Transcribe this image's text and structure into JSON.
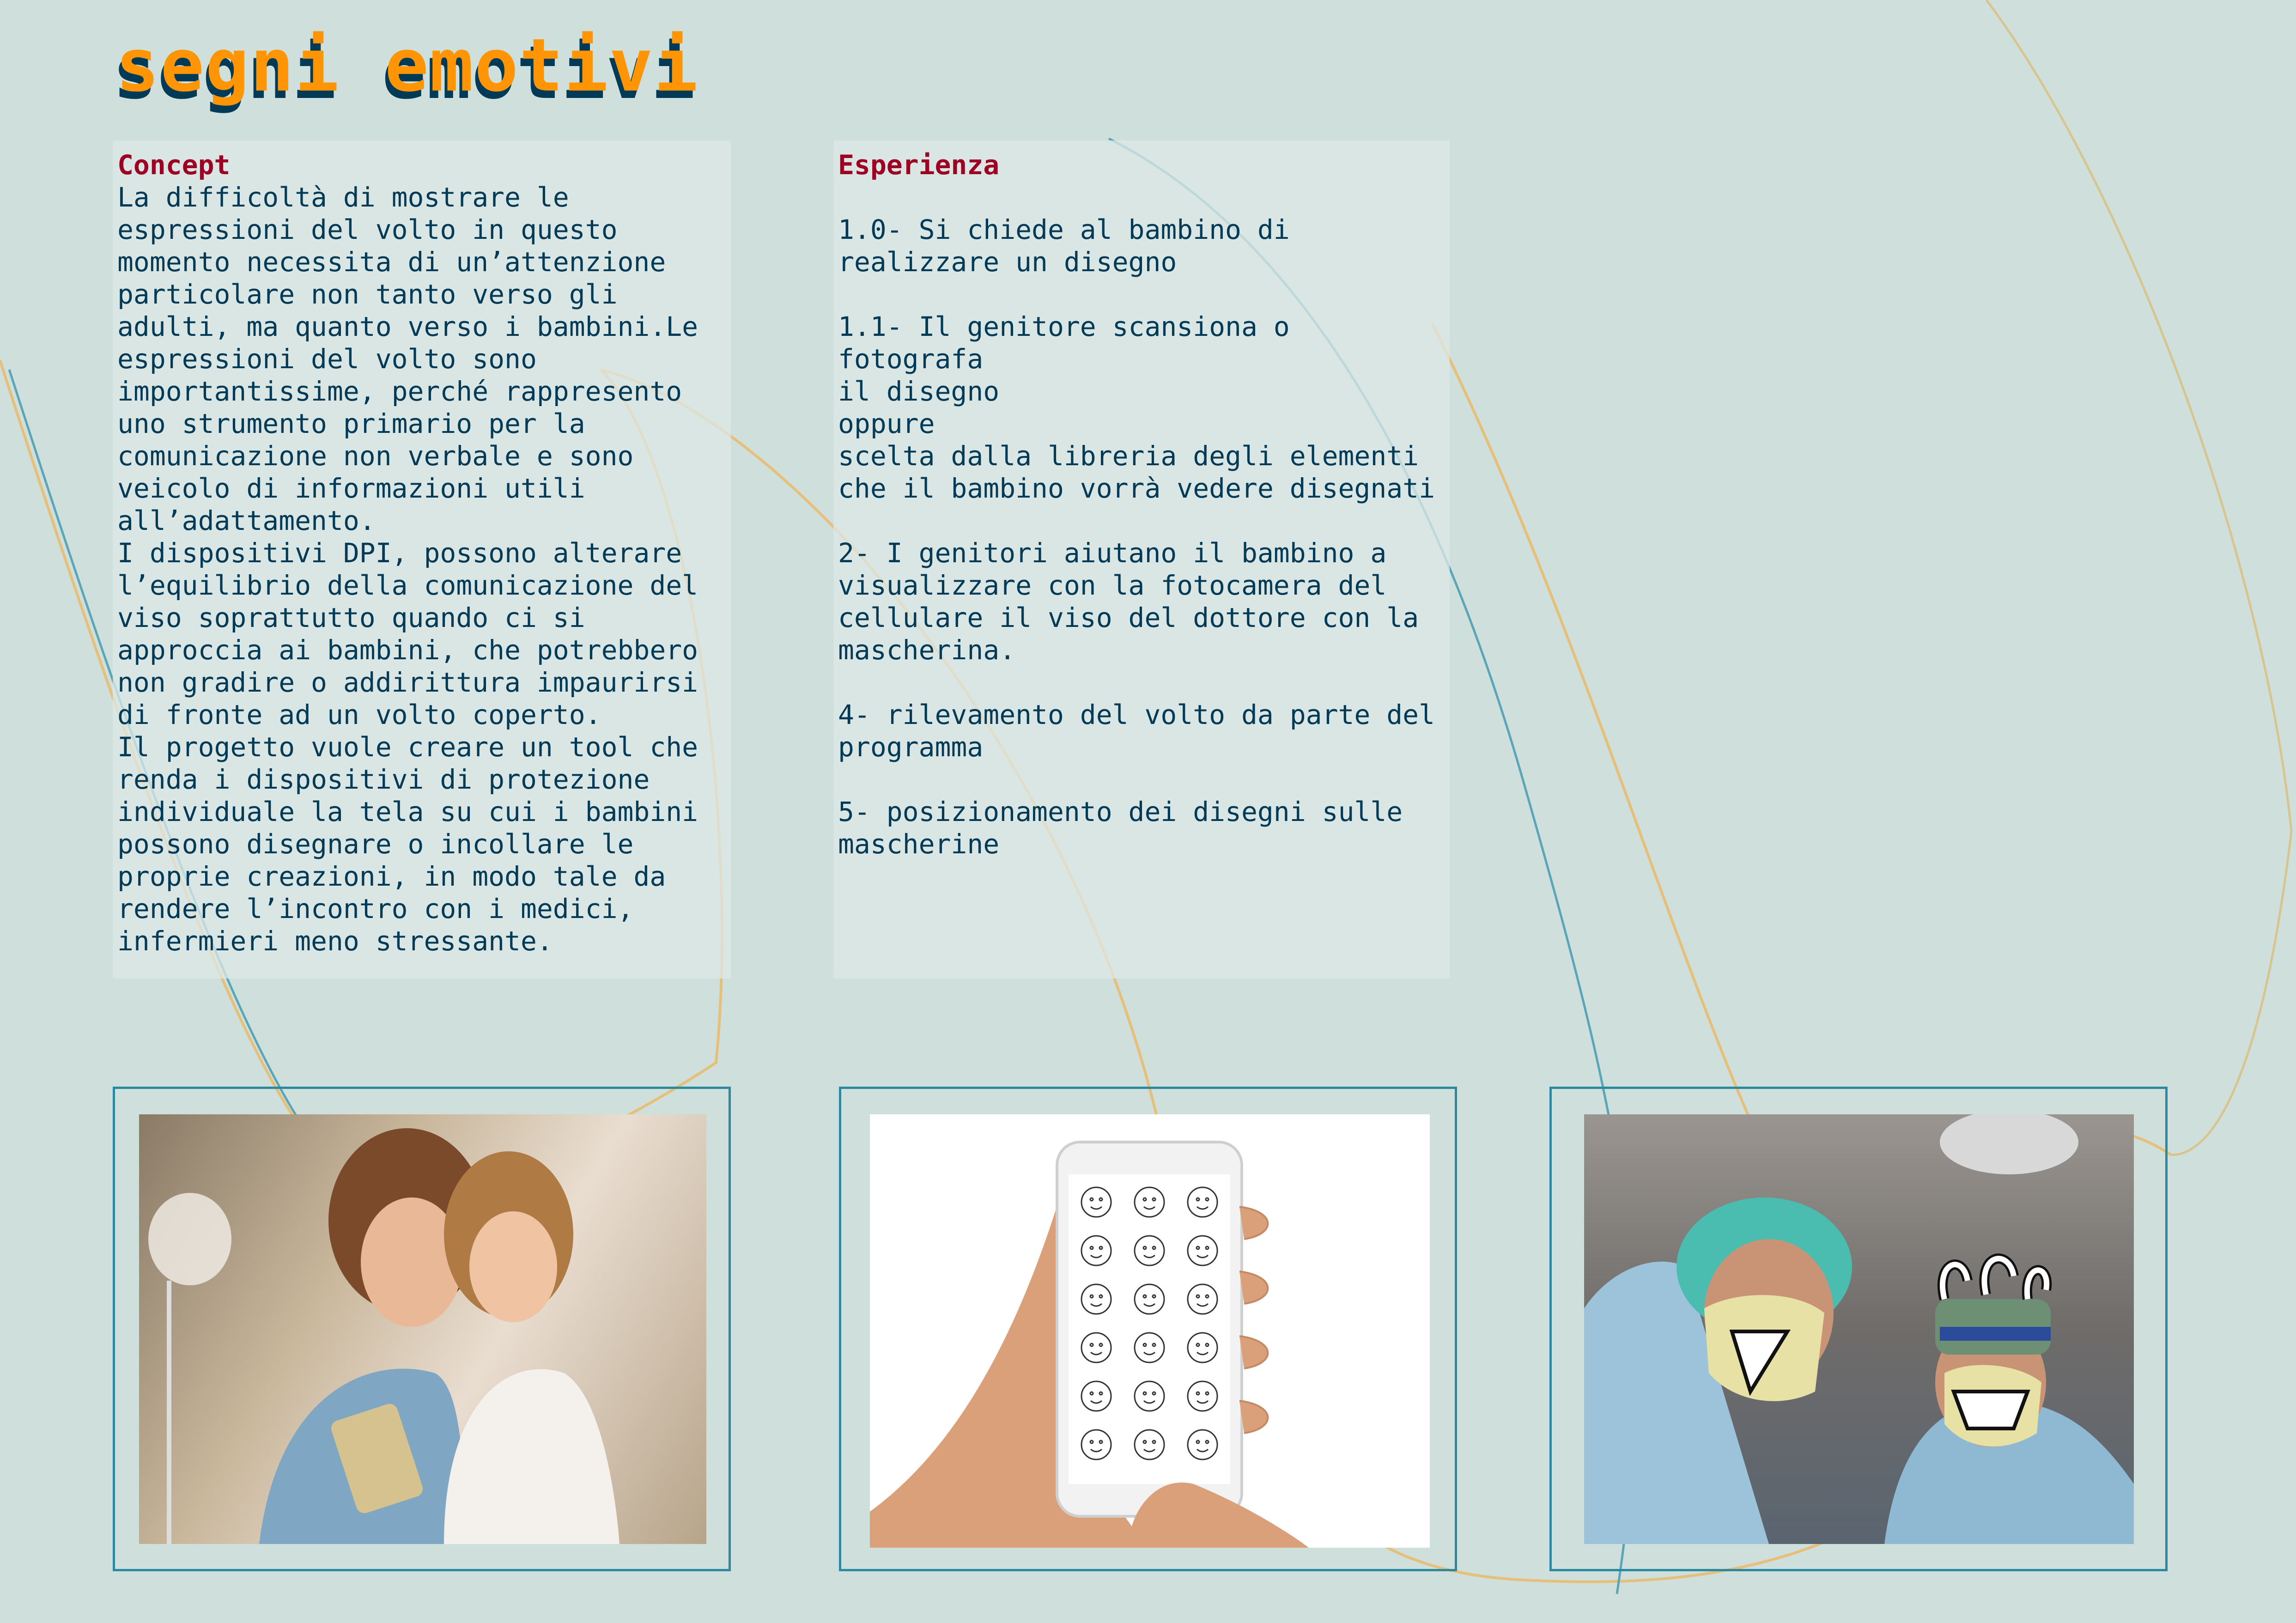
{
  "title": "segni emotivi",
  "colors": {
    "background": "#cfe0dc",
    "title_front": "#ff9505",
    "title_shadow": "#003a57",
    "heading": "#9e0024",
    "text": "#003a57",
    "frame": "#2b8aa0"
  },
  "concept": {
    "heading": "Concept",
    "text": "La difficoltà di mostrare le\nespressioni del volto in questo\nmomento necessita di un’attenzione\nparticolare non tanto verso gli\nadulti, ma quanto verso i bambini.Le\nespressioni del volto sono\nimportantissime, perché rappresento\nuno strumento primario per la\ncomunicazione non verbale e sono\nveicolo di informazioni utili\nall’adattamento.\nI dispositivi DPI, possono alterare\nl’equilibrio della comunicazione del\nviso soprattutto quando ci si\napproccia ai bambini, che potrebbero\nnon gradire o addirittura impaurirsi\ndi fronte ad un volto coperto.\nIl progetto vuole creare un tool che\nrenda i dispositivi di protezione\nindividuale la tela su cui i bambini\npossono disegnare o incollare le\nproprie creazioni, in modo tale da\nrendere l’incontro con i medici,\ninfermieri meno stressante."
  },
  "experience": {
    "heading": "Esperienza",
    "text": "\n1.0- Si chiede al bambino di\nrealizzare un disegno\n\n1.1- Il genitore scansiona o fotografa\nil disegno\noppure\nscelta dalla libreria degli elementi\nche il bambino vorrà vedere disegnati\n\n2- I genitori aiutano il bambino a\nvisualizzare con la fotocamera del\ncellulare il viso del dottore con la\nmascherina.\n\n4- rilevamento del volto da parte del\nprogramma\n\n5- posizionamento dei disegni sulle\nmascherine"
  },
  "photos": [
    {
      "subject": "mother-and-daughter-with-phone"
    },
    {
      "subject": "hand-holding-phone-with-drawn-faces"
    },
    {
      "subject": "doctors-with-drawn-mask-faces"
    }
  ]
}
